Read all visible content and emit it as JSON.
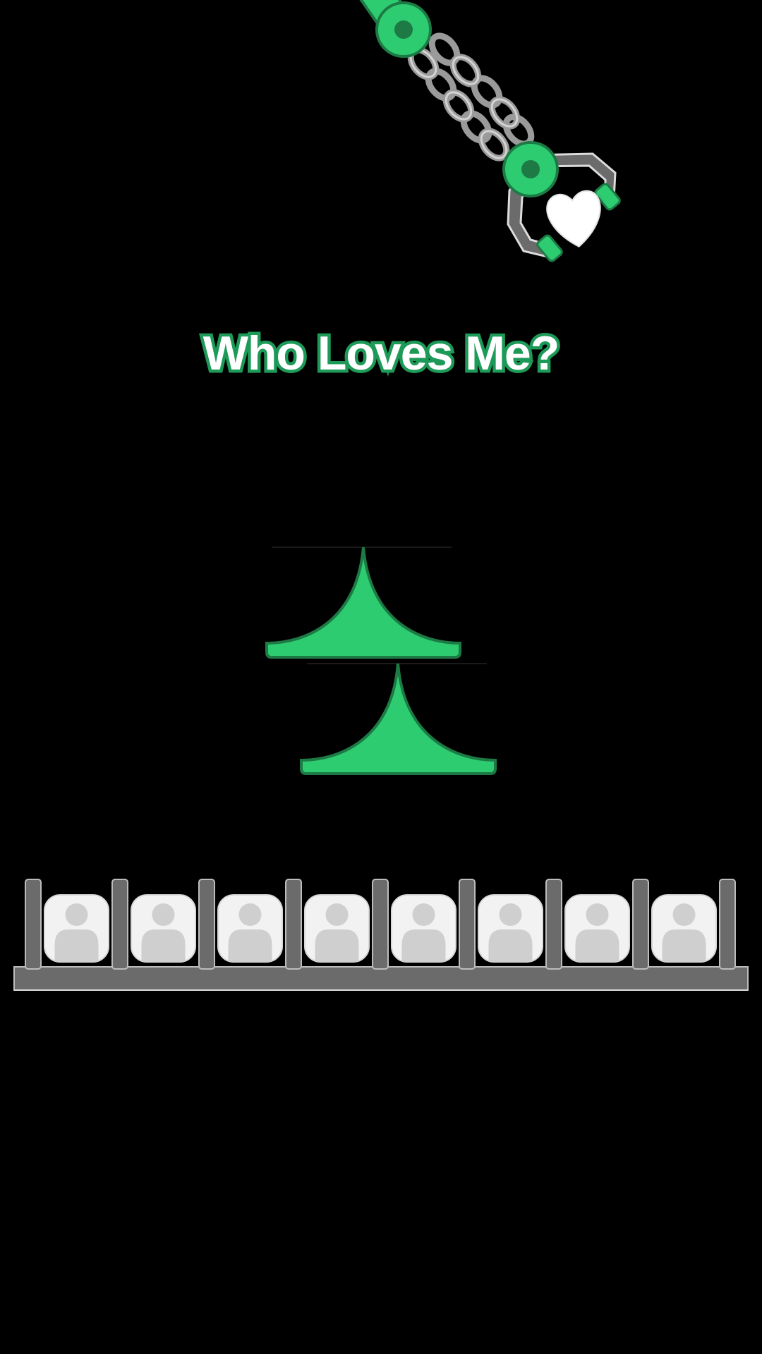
{
  "game": {
    "title": "Who Loves Me?",
    "colors": {
      "background": "#000000",
      "accent_green": "#2ecc71",
      "dark_green": "#1d7a45",
      "metal_gray": "#6b6b6b",
      "chain_gray": "#a8a8a8",
      "tile_bg": "#f2f2f2",
      "avatar_gray": "#cfcfcf",
      "heart": "#ffffff"
    },
    "claw": {
      "held_item": "heart-icon",
      "link_count": 2
    },
    "bumpers": {
      "count": 2,
      "shape": "green-spike-bumper"
    },
    "rack": {
      "slots": [
        {
          "icon": "user-avatar-icon"
        },
        {
          "icon": "user-avatar-icon"
        },
        {
          "icon": "user-avatar-icon"
        },
        {
          "icon": "user-avatar-icon"
        },
        {
          "icon": "user-avatar-icon"
        },
        {
          "icon": "user-avatar-icon"
        },
        {
          "icon": "user-avatar-icon"
        },
        {
          "icon": "user-avatar-icon"
        }
      ]
    }
  }
}
